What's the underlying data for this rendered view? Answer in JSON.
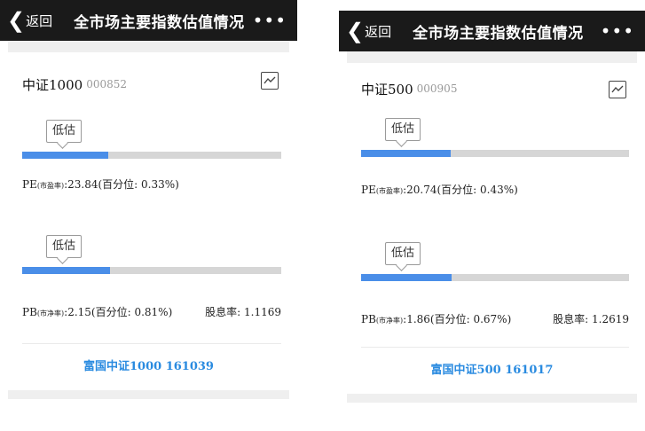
{
  "screens": [
    {
      "navbar": {
        "back_label": "返回",
        "title": "全市场主要指数估值情况",
        "more_label": "•••"
      },
      "index": {
        "name": "中证1000",
        "code": "000852"
      },
      "pe": {
        "tag": "低估",
        "prefix": "PE",
        "sub": "(市盈率)",
        "text": ":23.84(百分位: 0.33%)",
        "percentile": 0.33
      },
      "pb": {
        "tag": "低估",
        "prefix": "PB",
        "sub": "(市净率)",
        "text": ":2.15(百分位: 0.81%)",
        "percentile": 0.81
      },
      "dividend": "股息率: 1.1169",
      "fund": "富国中证1000  161039"
    },
    {
      "navbar": {
        "back_label": "返回",
        "title": "全市场主要指数估值情况",
        "more_label": "•••"
      },
      "index": {
        "name": "中证500",
        "code": "000905"
      },
      "pe": {
        "tag": "低估",
        "prefix": "PE",
        "sub": "(市盈率)",
        "text": ":20.74(百分位: 0.43%)",
        "percentile": 0.43
      },
      "pb": {
        "tag": "低估",
        "prefix": "PB",
        "sub": "(市净率)",
        "text": ":1.86(百分位: 0.67%)",
        "percentile": 0.67
      },
      "dividend": "股息率: 1.2619",
      "fund": "富国中证500  161017"
    }
  ],
  "colors": {
    "navbar": "#1a1a1a",
    "bar_fill": "#4a8ee8",
    "bar_track": "#d6d6d6",
    "link": "#2a8be0"
  },
  "icons": {
    "back": "chevron-left-icon",
    "more": "more-dots-icon",
    "chart": "line-chart-icon"
  }
}
